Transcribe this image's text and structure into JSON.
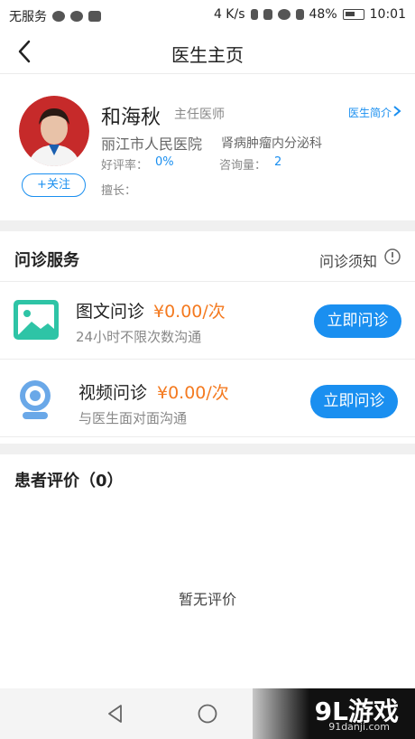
{
  "status_bar": {
    "carrier": "无服务",
    "speed": "4 K/s",
    "battery": "48%",
    "time": "10:01"
  },
  "nav": {
    "title": "医生主页"
  },
  "doctor": {
    "name": "和海秋",
    "title": "主任医师",
    "intro_link": "医生简介",
    "hospital": "丽江市人民医院",
    "department": "肾病肿瘤内分泌科",
    "rating_label": "好评率：",
    "rating_value": "0%",
    "consult_label": "咨询量：",
    "consult_value": "2",
    "specialty_label": "擅长：",
    "follow_label": "+关注"
  },
  "services": {
    "title": "问诊服务",
    "notice": "问诊须知",
    "items": [
      {
        "name": "图文问诊",
        "price": "¥0.00/次",
        "desc": "24小时不限次数沟通",
        "button": "立即问诊"
      },
      {
        "name": "视频问诊",
        "price": "¥0.00/次",
        "desc": "与医生面对面沟通",
        "button": "立即问诊"
      }
    ]
  },
  "reviews": {
    "title": "患者评价（0）",
    "empty": "暂无评价"
  },
  "watermark": {
    "brand": "9L游戏",
    "url": "91danji.com"
  },
  "colors": {
    "accent": "#1a8ff0",
    "price": "#f47a20",
    "image_icon": "#2ec4a6"
  }
}
